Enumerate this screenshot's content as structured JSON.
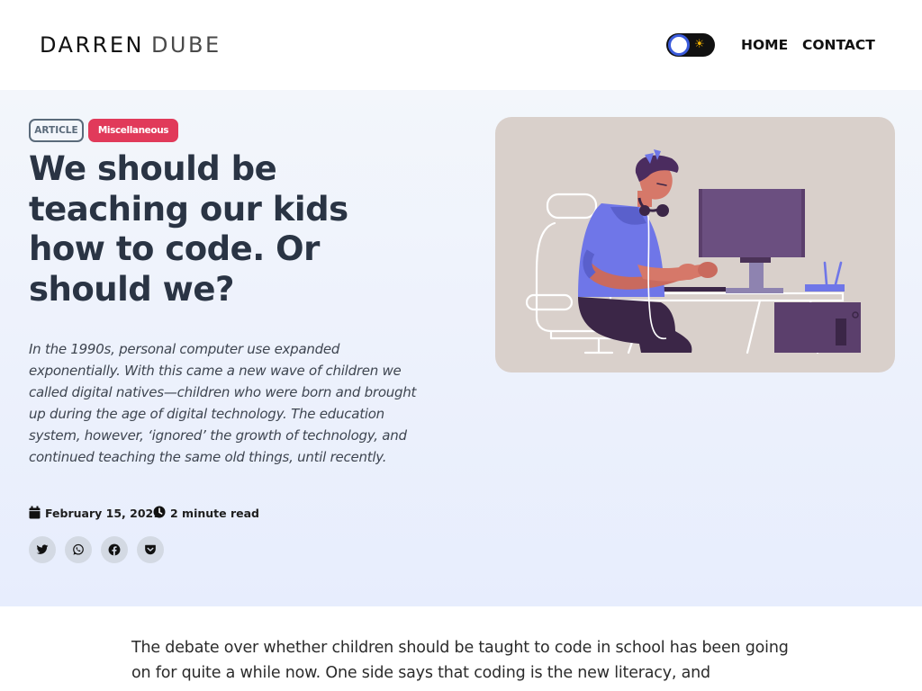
{
  "brand": {
    "first": "DARREN",
    "last": "DUBE"
  },
  "nav": {
    "home": "HOME",
    "contact": "CONTACT"
  },
  "theme_toggle": {
    "icon": "sun-icon",
    "state": "light"
  },
  "tags": {
    "article": "ARTICLE",
    "category": "Miscellaneous"
  },
  "post": {
    "title": "We should be teaching our kids how to code. Or should we?",
    "excerpt": "In the 1990s, personal computer use expanded exponentially. With this came a new wave of children we called digital natives—children who were born and brought up during the age of digital technology. The education system, however, ‘ignored’ the growth of technology, and continued teaching the same old things, until recently.",
    "date": "February 15, 2021",
    "read_time": "2 minute read"
  },
  "share": [
    {
      "icon": "twitter-icon"
    },
    {
      "icon": "whatsapp-icon"
    },
    {
      "icon": "facebook-icon"
    },
    {
      "icon": "pocket-icon"
    }
  ],
  "hero_image": {
    "icon": "person-coding-illustration"
  },
  "content": {
    "intro": "The debate over whether children should be taught to code in school has been going on for quite a while now. One side says that coding is the new literacy, and"
  },
  "colors": {
    "title": "#2a3444",
    "category_tag": "#e13a5a",
    "hero_bg_top": "#f3f6fb",
    "hero_bg_bottom": "#e7edfd",
    "image_bg": "#d9d0cb",
    "toggle_knob_border": "#3b5bdb"
  }
}
